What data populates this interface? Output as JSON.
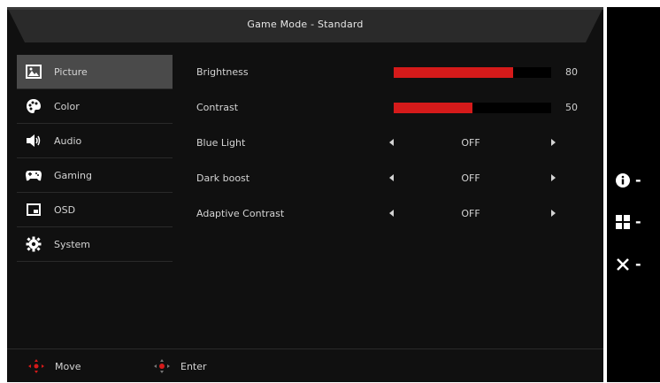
{
  "header": {
    "title": "Game Mode - Standard"
  },
  "sidebar": {
    "items": [
      {
        "label": "Picture",
        "icon": "picture-icon",
        "active": true
      },
      {
        "label": "Color",
        "icon": "palette-icon",
        "active": false
      },
      {
        "label": "Audio",
        "icon": "speaker-icon",
        "active": false
      },
      {
        "label": "Gaming",
        "icon": "gamepad-icon",
        "active": false
      },
      {
        "label": "OSD",
        "icon": "osd-icon",
        "active": false
      },
      {
        "label": "System",
        "icon": "gear-icon",
        "active": false
      }
    ]
  },
  "settings": {
    "brightness": {
      "label": "Brightness",
      "value": "80",
      "fraction": 0.76
    },
    "contrast": {
      "label": "Contrast",
      "value": "50",
      "fraction": 0.5
    },
    "blue_light": {
      "label": "Blue Light",
      "value": "OFF"
    },
    "dark_boost": {
      "label": "Dark boost",
      "value": "OFF"
    },
    "adaptive_contrast": {
      "label": "Adaptive Contrast",
      "value": "OFF"
    }
  },
  "footer": {
    "move_label": "Move",
    "enter_label": "Enter"
  },
  "side_keys": [
    {
      "icon": "info-icon",
      "symbol": "-"
    },
    {
      "icon": "grid-icon",
      "symbol": "-"
    },
    {
      "icon": "close-icon",
      "symbol": "-"
    }
  ],
  "colors": {
    "accent": "#d51a1a",
    "active_bg": "#4a4a4a",
    "panel_bg": "#101010"
  }
}
